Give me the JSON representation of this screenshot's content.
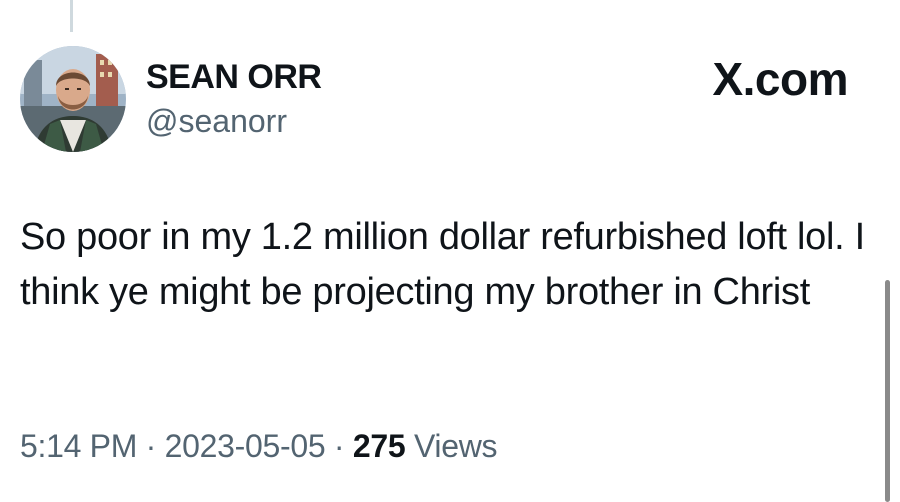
{
  "author": {
    "display_name": "SEAN ORR",
    "handle": "@seanorr"
  },
  "site_label": "X.com",
  "tweet": {
    "text": "So poor in my 1.2 million dollar refurbished loft lol. I think ye might be projecting my brother in Christ"
  },
  "meta": {
    "time": "5:14 PM",
    "separator": "·",
    "date": "2023-05-05",
    "views_count": "275",
    "views_label": "Views"
  },
  "colors": {
    "text_primary": "#0f1419",
    "text_secondary": "#536471",
    "thread_line": "#cfd9de"
  },
  "icons": {
    "avatar": "profile-photo"
  }
}
